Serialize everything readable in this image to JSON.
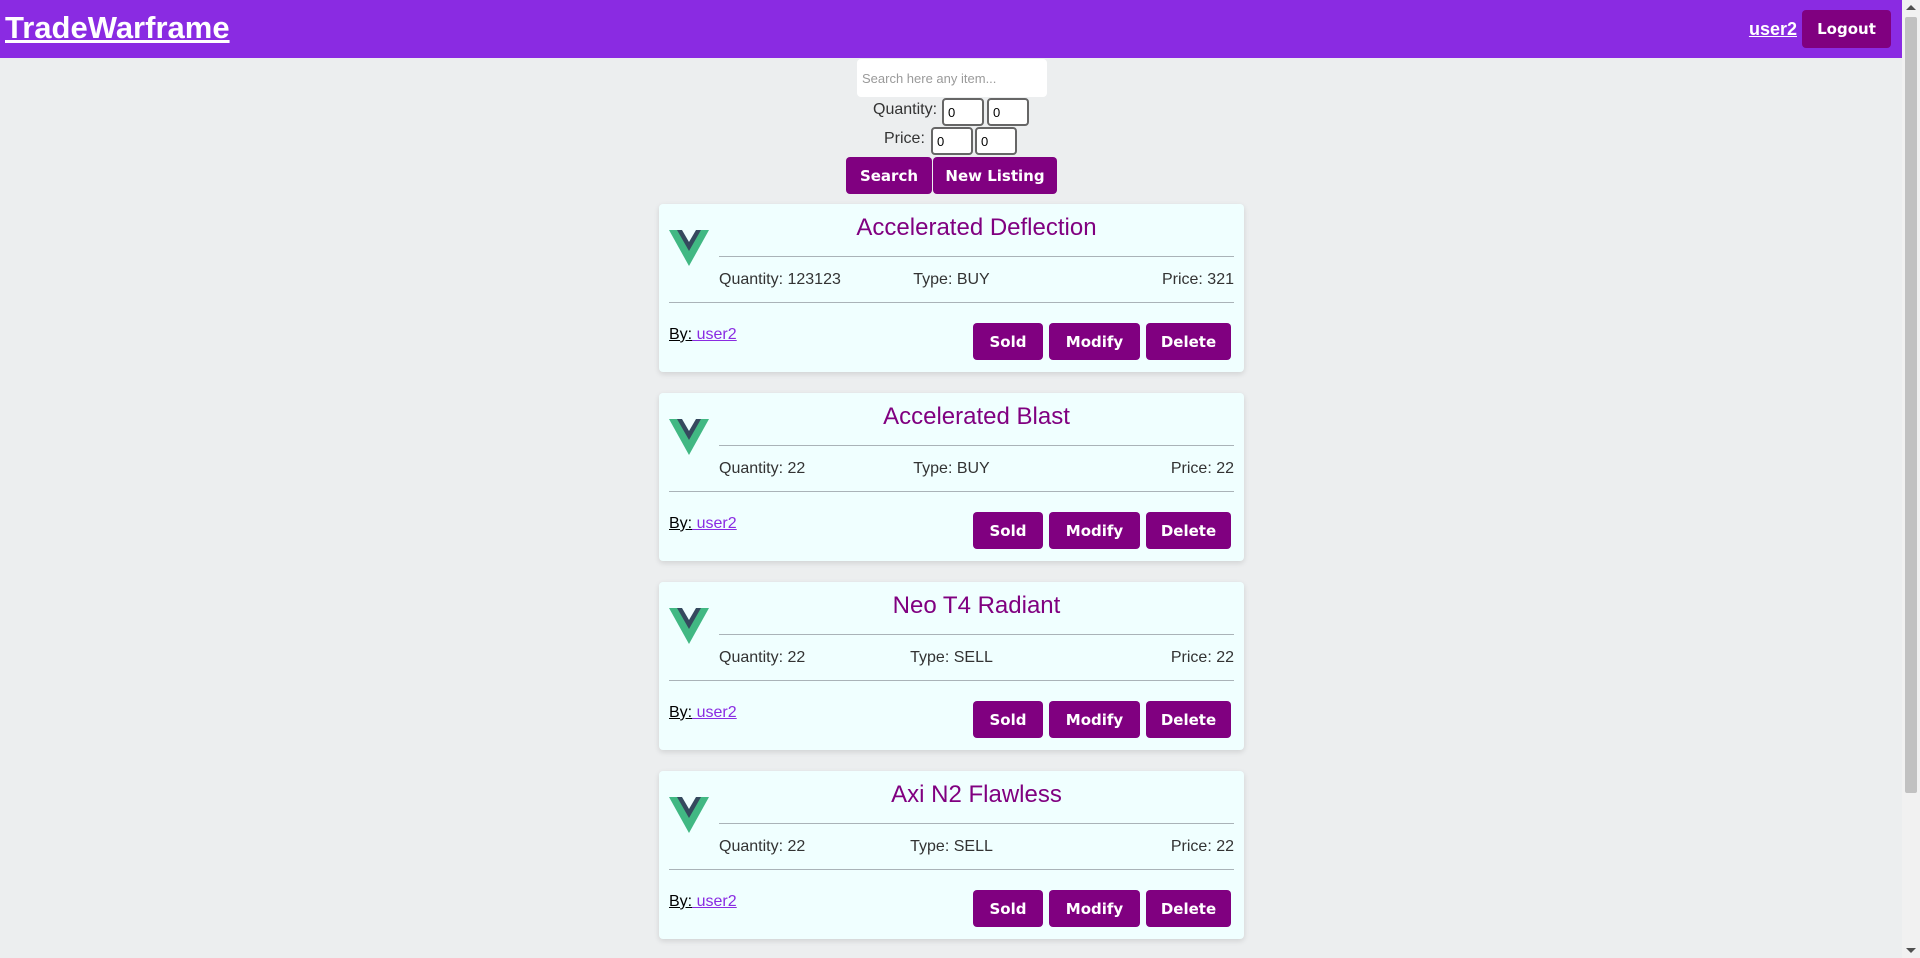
{
  "app": {
    "brand": "TradeWarframe",
    "username": "user2",
    "logout_label": "Logout"
  },
  "filters": {
    "search_placeholder": "Search here any item...",
    "quantity_label": "Quantity:",
    "quantity_min": "0",
    "quantity_max": "0",
    "price_label": "Price:",
    "price_min": "0",
    "price_max": "0",
    "search_label": "Search",
    "new_listing_label": "New Listing"
  },
  "listing_labels": {
    "by": "By:",
    "sold": "Sold",
    "modify": "Modify",
    "delete": "Delete"
  },
  "listings": [
    {
      "title": "Accelerated Deflection",
      "quantity": "Quantity: 123123",
      "type": "Type: BUY",
      "price": "Price: 321",
      "user": " user2"
    },
    {
      "title": "Accelerated Blast",
      "quantity": "Quantity: 22",
      "type": "Type: BUY",
      "price": "Price: 22",
      "user": " user2"
    },
    {
      "title": "Neo T4 Radiant",
      "quantity": "Quantity: 22",
      "type": "Type: SELL",
      "price": "Price: 22",
      "user": " user2"
    },
    {
      "title": "Axi N2 Flawless",
      "quantity": "Quantity: 22",
      "type": "Type: SELL",
      "price": "Price: 22",
      "user": " user2"
    }
  ],
  "icons": {
    "listing_logo": "vue-logo-icon"
  },
  "colors": {
    "navbar": "#8a2be2",
    "button": "#800080",
    "card_background": "#f0ffff",
    "title": "#800080",
    "logo_green": "#41b883",
    "logo_dark": "#35495e"
  }
}
